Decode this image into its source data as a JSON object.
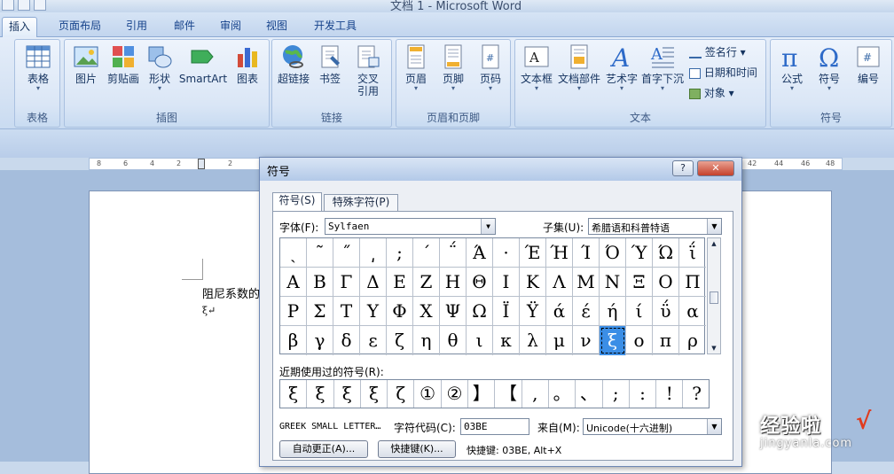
{
  "window": {
    "title": "文档 1 - Microsoft Word"
  },
  "tabs": [
    {
      "label": "插入",
      "active": true
    },
    {
      "label": "页面布局"
    },
    {
      "label": "引用"
    },
    {
      "label": "邮件"
    },
    {
      "label": "审阅"
    },
    {
      "label": "视图"
    },
    {
      "label": "开发工具"
    }
  ],
  "ribbon": {
    "groups": [
      "表格",
      "插图",
      "链接",
      "页眉和页脚",
      "文本",
      "符号"
    ],
    "buttons": {
      "table": "表格",
      "picture": "图片",
      "clipart": "剪贴画",
      "shapes": "形状",
      "smartart": "SmartArt",
      "chart": "图表",
      "hyperlink": "超链接",
      "bookmark": "书签",
      "crossref_1": "交叉",
      "crossref_2": "引用",
      "header": "页眉",
      "footer": "页脚",
      "pagenum": "页码",
      "textbox": "文本框",
      "quickparts": "文档部件",
      "wordart": "艺术字",
      "dropcap": "首字下沉",
      "signature": "签名行",
      "datetime": "日期和时间",
      "object": "对象",
      "equation": "公式",
      "symbol": "符号",
      "numbering": "编号"
    }
  },
  "ruler": {
    "ticks": [
      "8",
      "6",
      "4",
      "2",
      "2",
      "42",
      "44",
      "46",
      "48"
    ]
  },
  "document": {
    "line1": "阻尼系数的",
    "line2": "ξ↵"
  },
  "dialog": {
    "title": "符号",
    "tab_symbols": "符号(S)",
    "tab_special": "特殊字符(P)",
    "font_label": "字体(F):",
    "font_value": "Sylfaen",
    "subset_label": "子集(U):",
    "subset_value": "希腊语和科普特语",
    "grid": [
      [
        "ˏ",
        "˜",
        "˝",
        "͵",
        ";",
        "΄",
        "΅",
        "Ά",
        "·",
        "Έ",
        "Ή",
        "Ί",
        "Ό",
        "Ύ",
        "Ώ",
        "ΐ"
      ],
      [
        "Α",
        "Β",
        "Γ",
        "Δ",
        "Ε",
        "Ζ",
        "Η",
        "Θ",
        "Ι",
        "Κ",
        "Λ",
        "Μ",
        "Ν",
        "Ξ",
        "Ο",
        "Π"
      ],
      [
        "Ρ",
        "Σ",
        "Τ",
        "Υ",
        "Φ",
        "Χ",
        "Ψ",
        "Ω",
        "Ϊ",
        "Ϋ",
        "ά",
        "έ",
        "ή",
        "ί",
        "ΰ",
        "α"
      ],
      [
        "β",
        "γ",
        "δ",
        "ε",
        "ζ",
        "η",
        "θ",
        "ι",
        "κ",
        "λ",
        "μ",
        "ν",
        "ξ",
        "ο",
        "π",
        "ρ"
      ]
    ],
    "selected": {
      "row": 3,
      "col": 12
    },
    "recent_label": "近期使用过的符号(R):",
    "recent": [
      "ξ",
      "ξ",
      "ξ",
      "ξ",
      "ζ",
      "①",
      "②",
      "】",
      "【",
      ",",
      "。",
      "、",
      ";",
      ":",
      "!",
      "?"
    ],
    "char_name": "GREEK SMALL LETTER…",
    "code_label": "字符代码(C):",
    "code_value": "03BE",
    "from_label": "来自(M):",
    "from_value": "Unicode(十六进制)",
    "autocorrect_btn": "自动更正(A)...",
    "shortcut_btn": "快捷键(K)...",
    "shortcut_text": "快捷键: 03BE, Alt+X",
    "help_btn": "?"
  },
  "watermark": {
    "line1": "经验啦",
    "line2": "jingyanla.com",
    "check": "√"
  }
}
